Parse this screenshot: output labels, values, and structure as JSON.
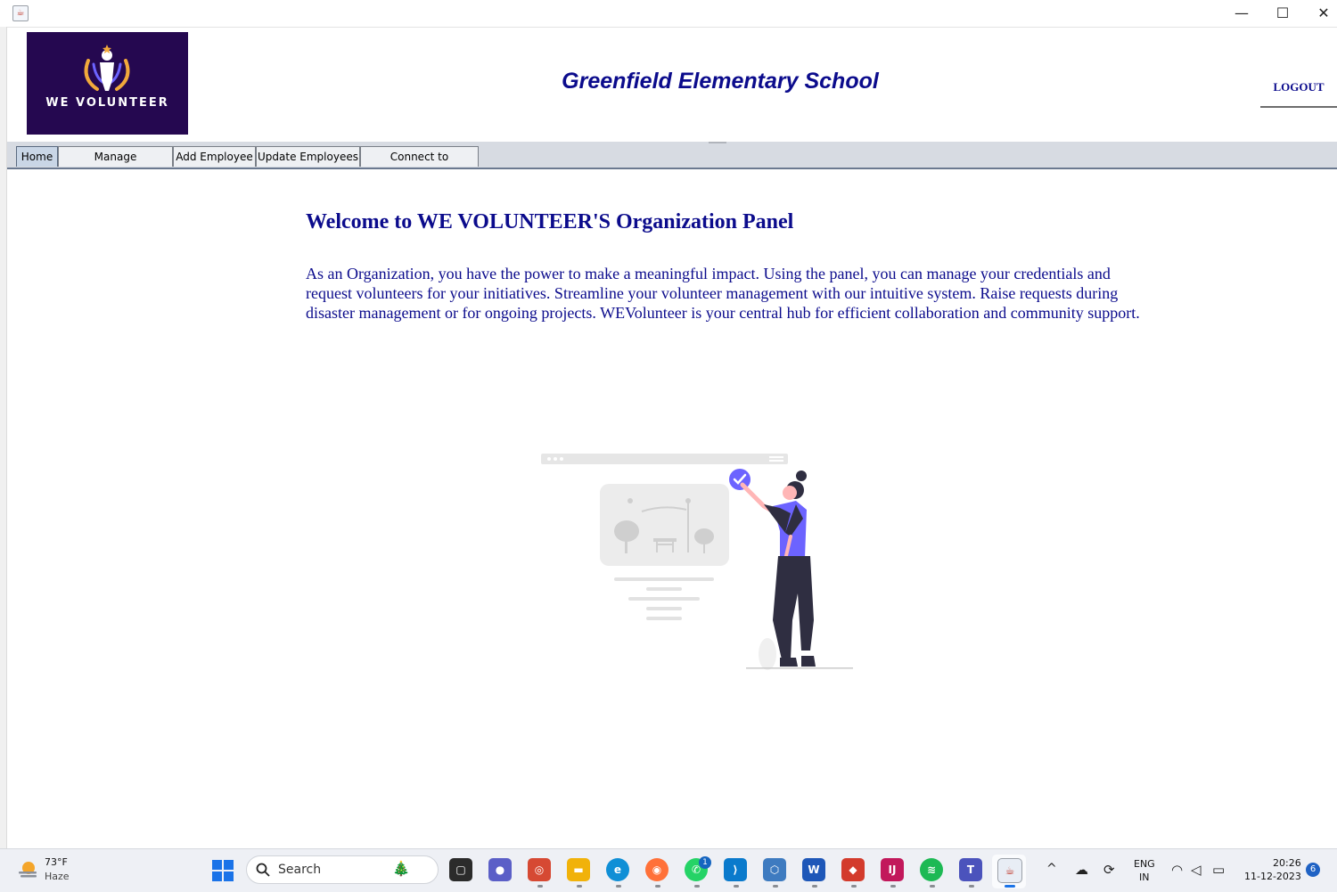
{
  "window": {
    "min_glyph": "—",
    "max_glyph": "☐",
    "close_glyph": "✕"
  },
  "header": {
    "logo_text": "WE VOLUNTEER",
    "school_name": "Greenfield Elementary School",
    "logout_label": "LOGOUT"
  },
  "tabs": [
    {
      "label": "Home",
      "active": true
    },
    {
      "label": "Manage Organization",
      "active": false
    },
    {
      "label": "Add Employee",
      "active": false
    },
    {
      "label": "Update Employees",
      "active": false
    },
    {
      "label": "Connect to Volunteers",
      "active": false
    }
  ],
  "main": {
    "welcome_title": "Welcome to WE VOLUNTEER'S Organization Panel",
    "description": "As an Organization, you have the power to make a meaningful impact. Using the panel, you can manage your credentials and request volunteers for your initiatives. Streamline your volunteer management with our intuitive system. Raise requests during disaster management or for ongoing projects. WEVolunteer is your central hub for efficient collaboration and community support."
  },
  "taskbar": {
    "temperature": "73°F",
    "weather": "Haze",
    "search_label": "Search",
    "whatsapp_badge": "1",
    "lang_top": "ENG",
    "lang_bottom": "IN",
    "time": "20:26",
    "date": "11-12-2023",
    "notifications": "6"
  },
  "colors": {
    "brand_text": "#0b0b8c",
    "logo_bg": "#250850",
    "accent_purple": "#6c63ff"
  }
}
